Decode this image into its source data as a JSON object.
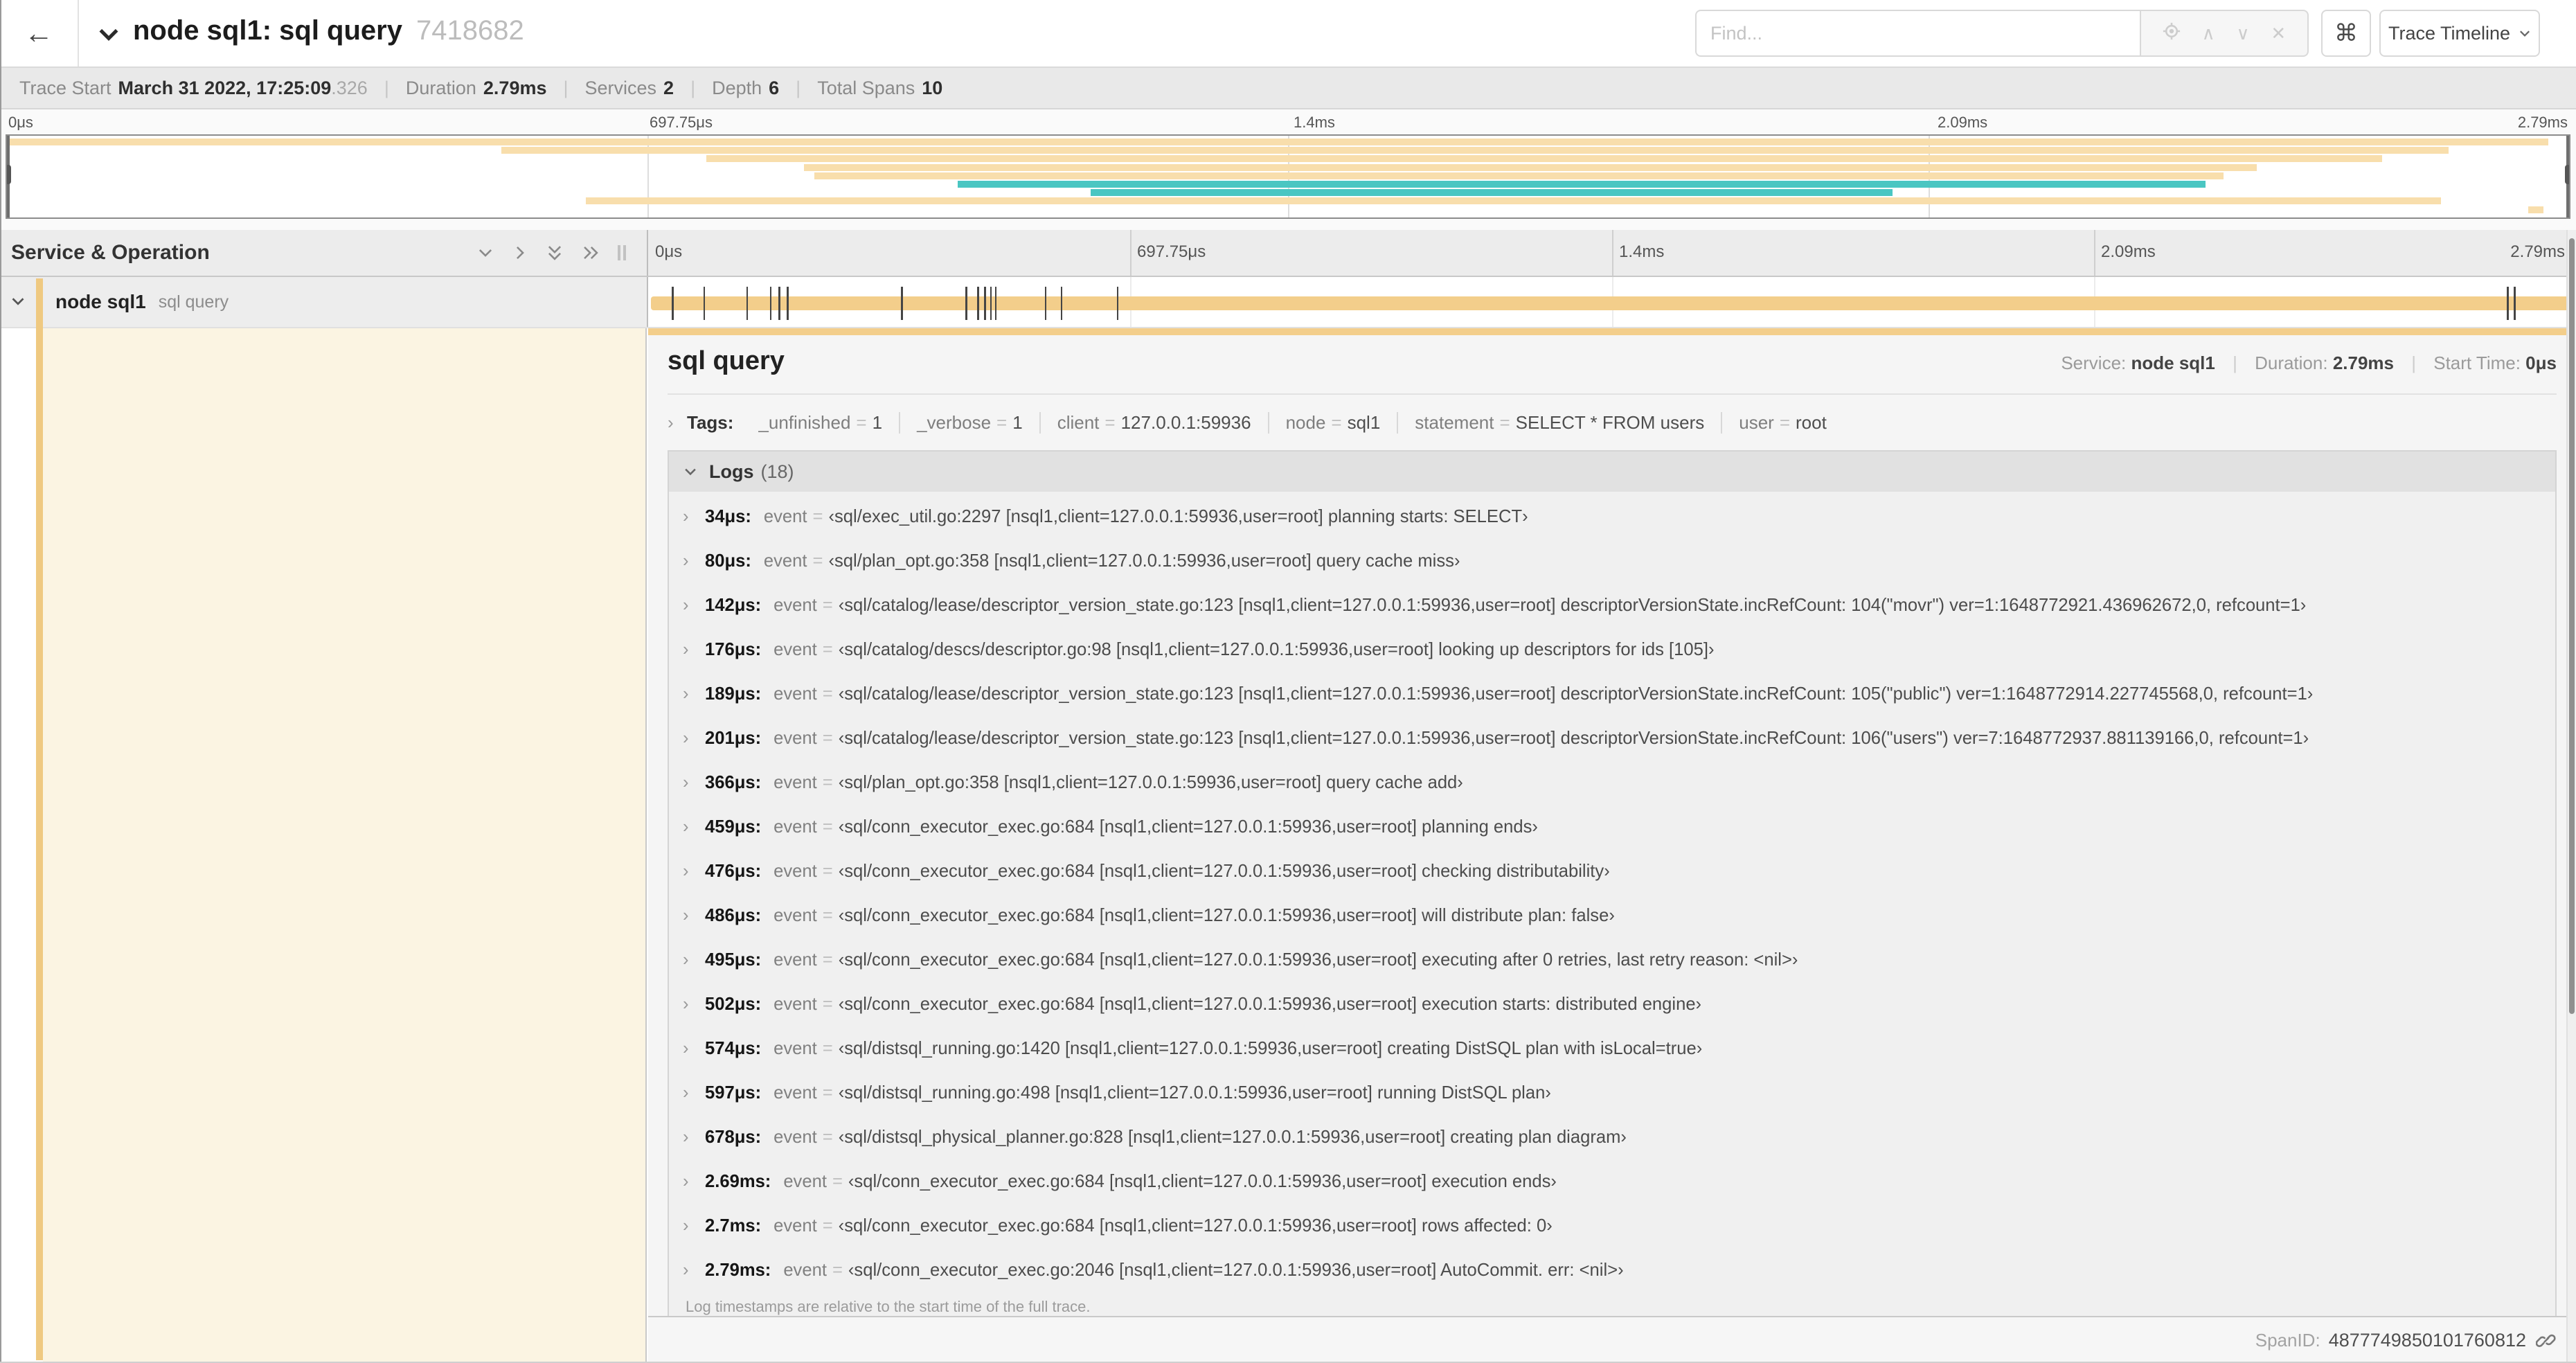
{
  "colors": {
    "tan": "#F3CE8B",
    "tan-light": "#F8DEAC",
    "teal": "#4AC6C2",
    "cream": "#FBF4E2",
    "strip": "#EFC981"
  },
  "header": {
    "back_glyph": "←",
    "title": "node sql1: sql query",
    "trace_id": "7418682",
    "find": {
      "placeholder": "Find..."
    },
    "find_tools": {
      "prev_glyph": "∧",
      "next_glyph": "∨",
      "clear_glyph": "✕"
    },
    "shortcut_glyph": "⌘",
    "view_button": "Trace Timeline"
  },
  "summary": {
    "items": [
      {
        "label": "Trace Start",
        "value": "March 31 2022, 17:25:09",
        "suffix": ".326"
      },
      {
        "label": "Duration",
        "value": "2.79ms"
      },
      {
        "label": "Services",
        "value": "2"
      },
      {
        "label": "Depth",
        "value": "6"
      },
      {
        "label": "Total Spans",
        "value": "10"
      }
    ]
  },
  "minimap": {
    "ticks": [
      {
        "pct": 0,
        "label": "0μs"
      },
      {
        "pct": 25,
        "label": "697.75μs"
      },
      {
        "pct": 50,
        "label": "1.4ms"
      },
      {
        "pct": 75,
        "label": "2.09ms"
      },
      {
        "pct": 100,
        "label": "2.79ms"
      }
    ],
    "grid_pcts": [
      25,
      50,
      75
    ],
    "spans": [
      {
        "start": 0,
        "end": 99.2,
        "color": "tan-light"
      },
      {
        "start": 19.3,
        "end": 95.3,
        "color": "tan-light"
      },
      {
        "start": 27.3,
        "end": 92.7,
        "color": "tan-light"
      },
      {
        "start": 31.1,
        "end": 87.8,
        "color": "tan-light"
      },
      {
        "start": 31.5,
        "end": 86.5,
        "color": "tan-light"
      },
      {
        "start": 37.1,
        "end": 85.8,
        "color": "teal"
      },
      {
        "start": 42.3,
        "end": 73.6,
        "color": "teal"
      },
      {
        "start": 22.6,
        "end": 95.0,
        "color": "tan-light"
      },
      {
        "start": 98.4,
        "end": 99.0,
        "color": "tan-light"
      }
    ]
  },
  "timeline": {
    "column_header": "Service & Operation",
    "ruler": {
      "sections": [
        {
          "pct": 0,
          "label": "0μs"
        },
        {
          "pct": 25,
          "label": "697.75μs"
        },
        {
          "pct": 50,
          "label": "1.4ms"
        },
        {
          "pct": 75,
          "label": "2.09ms"
        }
      ],
      "end_label": "2.79ms"
    },
    "row": {
      "service": "node sql1",
      "operation": "sql query",
      "bar": {
        "start": 0.15,
        "end": 99.85
      },
      "tick_pcts": [
        1.22,
        2.87,
        5.09,
        6.31,
        6.77,
        7.2,
        13.12,
        16.45,
        17.06,
        17.42,
        17.74,
        17.99,
        20.57,
        21.4,
        24.3,
        96.42,
        96.77,
        99.8
      ]
    }
  },
  "detail": {
    "title": "sql query",
    "meta": {
      "service_label": "Service:",
      "service": "node sql1",
      "duration_label": "Duration:",
      "duration": "2.79ms",
      "start_label": "Start Time:",
      "start": "0μs"
    },
    "tags_label": "Tags:",
    "tags": [
      {
        "key": "_unfinished",
        "value": "1"
      },
      {
        "key": "_verbose",
        "value": "1"
      },
      {
        "key": "client",
        "value": "127.0.0.1:59936"
      },
      {
        "key": "node",
        "value": "sql1"
      },
      {
        "key": "statement",
        "value": "SELECT * FROM users"
      },
      {
        "key": "user",
        "value": "root"
      }
    ],
    "logs_label": "Logs",
    "logs_count": "(18)",
    "log_field_key": "event",
    "logs": [
      {
        "t": "34μs",
        "v": "‹sql/exec_util.go:2297 [nsql1,client=127.0.0.1:59936,user=root] planning starts: SELECT›"
      },
      {
        "t": "80μs",
        "v": "‹sql/plan_opt.go:358 [nsql1,client=127.0.0.1:59936,user=root] query cache miss›"
      },
      {
        "t": "142μs",
        "v": "‹sql/catalog/lease/descriptor_version_state.go:123 [nsql1,client=127.0.0.1:59936,user=root] descriptorVersionState.incRefCount: 104(\"movr\") ver=1:1648772921.436962672,0, refcount=1›"
      },
      {
        "t": "176μs",
        "v": "‹sql/catalog/descs/descriptor.go:98 [nsql1,client=127.0.0.1:59936,user=root] looking up descriptors for ids [105]›"
      },
      {
        "t": "189μs",
        "v": "‹sql/catalog/lease/descriptor_version_state.go:123 [nsql1,client=127.0.0.1:59936,user=root] descriptorVersionState.incRefCount: 105(\"public\") ver=1:1648772914.227745568,0, refcount=1›"
      },
      {
        "t": "201μs",
        "v": "‹sql/catalog/lease/descriptor_version_state.go:123 [nsql1,client=127.0.0.1:59936,user=root] descriptorVersionState.incRefCount: 106(\"users\") ver=7:1648772937.881139166,0, refcount=1›"
      },
      {
        "t": "366μs",
        "v": "‹sql/plan_opt.go:358 [nsql1,client=127.0.0.1:59936,user=root] query cache add›"
      },
      {
        "t": "459μs",
        "v": "‹sql/conn_executor_exec.go:684 [nsql1,client=127.0.0.1:59936,user=root] planning ends›"
      },
      {
        "t": "476μs",
        "v": "‹sql/conn_executor_exec.go:684 [nsql1,client=127.0.0.1:59936,user=root] checking distributability›"
      },
      {
        "t": "486μs",
        "v": "‹sql/conn_executor_exec.go:684 [nsql1,client=127.0.0.1:59936,user=root] will distribute plan: false›"
      },
      {
        "t": "495μs",
        "v": "‹sql/conn_executor_exec.go:684 [nsql1,client=127.0.0.1:59936,user=root] executing after 0 retries, last retry reason: <nil>›"
      },
      {
        "t": "502μs",
        "v": "‹sql/conn_executor_exec.go:684 [nsql1,client=127.0.0.1:59936,user=root] execution starts: distributed engine›"
      },
      {
        "t": "574μs",
        "v": "‹sql/distsql_running.go:1420 [nsql1,client=127.0.0.1:59936,user=root] creating DistSQL plan with isLocal=true›"
      },
      {
        "t": "597μs",
        "v": "‹sql/distsql_running.go:498 [nsql1,client=127.0.0.1:59936,user=root] running DistSQL plan›"
      },
      {
        "t": "678μs",
        "v": "‹sql/distsql_physical_planner.go:828 [nsql1,client=127.0.0.1:59936,user=root] creating plan diagram›"
      },
      {
        "t": "2.69ms",
        "v": "‹sql/conn_executor_exec.go:684 [nsql1,client=127.0.0.1:59936,user=root] execution ends›"
      },
      {
        "t": "2.7ms",
        "v": "‹sql/conn_executor_exec.go:684 [nsql1,client=127.0.0.1:59936,user=root] rows affected: 0›"
      },
      {
        "t": "2.79ms",
        "v": "‹sql/conn_executor_exec.go:2046 [nsql1,client=127.0.0.1:59936,user=root] AutoCommit. err: <nil>›"
      }
    ],
    "footnote": "Log timestamps are relative to the start time of the full trace.",
    "span_id_label": "SpanID:",
    "span_id": "4877749850101760812"
  }
}
